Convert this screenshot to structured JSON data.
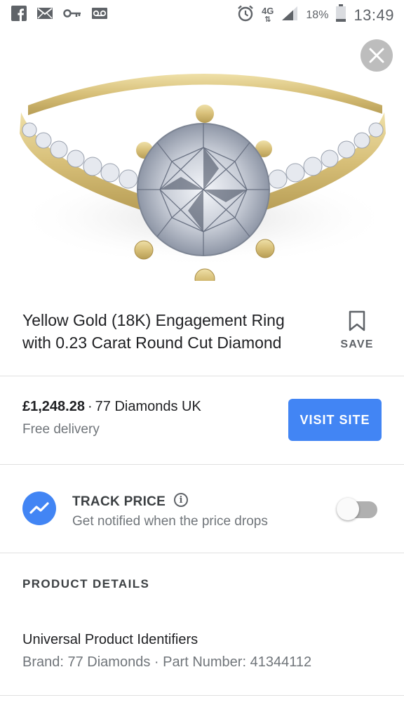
{
  "status_bar": {
    "icons_left": [
      "facebook-icon",
      "mail-icon",
      "key-icon",
      "voicemail-icon"
    ],
    "network": "4G",
    "battery": "18%",
    "time": "13:49"
  },
  "hero": {
    "image": "yellow-gold-diamond-ring",
    "close_icon": "close-icon"
  },
  "product": {
    "title": "Yellow Gold (18K) Engagement Ring with 0.23 Carat Round Cut Diamond",
    "save_label": "SAVE"
  },
  "offer": {
    "price": "£1,248.28",
    "separator": "·",
    "seller": "77 Diamonds UK",
    "delivery": "Free delivery",
    "visit_label": "VISIT SITE"
  },
  "track": {
    "title": "TRACK PRICE",
    "info_glyph": "i",
    "subtitle": "Get notified when the price drops",
    "enabled": false
  },
  "details": {
    "heading": "PRODUCT DETAILS",
    "upi_title": "Universal Product Identifiers",
    "upi_values": "Brand: 77 Diamonds · Part Number: 41344112"
  },
  "colors": {
    "accent": "#4285f4",
    "text_primary": "#202124",
    "text_secondary": "#70757a",
    "divider": "#e0e0e0",
    "gold": "#d9c27e"
  }
}
